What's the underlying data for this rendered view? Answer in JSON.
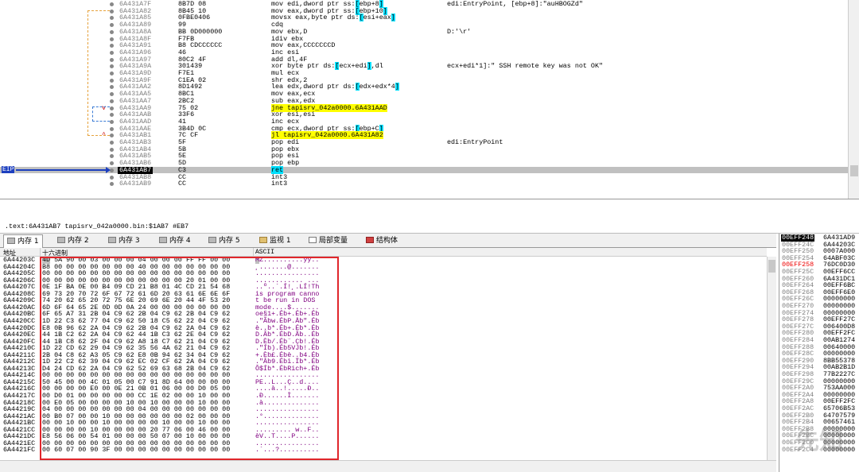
{
  "disasm": {
    "rows": [
      {
        "addr": "6A431A7F",
        "bytes": "8B7D 08",
        "instr": "mov edi,dword ptr ss:[ebp+8]",
        "comment": "edi:EntryPoint, [ebp+8]:\"auHBOGZd\""
      },
      {
        "addr": "6A431A82",
        "bytes": "8B45 10",
        "instr": "mov eax,dword ptr ss:[ebp+10]",
        "comment": ""
      },
      {
        "addr": "6A431A85",
        "bytes": "0FBE0406",
        "instr": "movsx eax,byte ptr ds:[esi+eax]",
        "comment": ""
      },
      {
        "addr": "6A431A89",
        "bytes": "99",
        "instr": "cdq",
        "comment": ""
      },
      {
        "addr": "6A431A8A",
        "bytes": "BB 0D000000",
        "instr": "mov ebx,D",
        "comment": "D:'\\r'"
      },
      {
        "addr": "6A431A8F",
        "bytes": "F7FB",
        "instr": "idiv ebx",
        "comment": ""
      },
      {
        "addr": "6A431A91",
        "bytes": "B8 CDCCCCCC",
        "instr": "mov eax,CCCCCCCD",
        "comment": ""
      },
      {
        "addr": "6A431A96",
        "bytes": "46",
        "instr": "inc esi",
        "comment": ""
      },
      {
        "addr": "6A431A97",
        "bytes": "80C2 4F",
        "instr": "add dl,4F",
        "comment": ""
      },
      {
        "addr": "6A431A9A",
        "bytes": "301439",
        "instr": "xor byte ptr ds:[ecx+edi],dl",
        "comment": "ecx+edi*1]:\" SSH remote key was not OK\""
      },
      {
        "addr": "6A431A9D",
        "bytes": "F7E1",
        "instr": "mul ecx",
        "comment": ""
      },
      {
        "addr": "6A431A9F",
        "bytes": "C1EA 02",
        "instr": "shr edx,2",
        "comment": ""
      },
      {
        "addr": "6A431AA2",
        "bytes": "8D1492",
        "instr": "lea edx,dword ptr ds:[edx+edx*4]",
        "comment": ""
      },
      {
        "addr": "6A431AA5",
        "bytes": "8BC1",
        "instr": "mov eax,ecx",
        "comment": ""
      },
      {
        "addr": "6A431AA7",
        "bytes": "2BC2",
        "instr": "sub eax,edx",
        "comment": ""
      },
      {
        "addr": "6A431AA9",
        "bytes": "75 02",
        "instr": "jne tapisrv_042a0000.6A431AAD",
        "comment": ""
      },
      {
        "addr": "6A431AAB",
        "bytes": "33F6",
        "instr": "xor esi,esi",
        "comment": ""
      },
      {
        "addr": "6A431AAD",
        "bytes": "41",
        "instr": "inc ecx",
        "comment": ""
      },
      {
        "addr": "6A431AAE",
        "bytes": "3B4D 0C",
        "instr": "cmp ecx,dword ptr ss:[ebp+C]",
        "comment": ""
      },
      {
        "addr": "6A431AB1",
        "bytes": "7C CF",
        "instr": "jl tapisrv_042a0000.6A431A82",
        "comment": ""
      },
      {
        "addr": "6A431AB3",
        "bytes": "5F",
        "instr": "pop edi",
        "comment": "edi:EntryPoint"
      },
      {
        "addr": "6A431AB4",
        "bytes": "5B",
        "instr": "pop ebx",
        "comment": ""
      },
      {
        "addr": "6A431AB5",
        "bytes": "5E",
        "instr": "pop esi",
        "comment": ""
      },
      {
        "addr": "6A431AB6",
        "bytes": "5D",
        "instr": "pop ebp",
        "comment": ""
      },
      {
        "addr": "6A431AB7",
        "bytes": "C3",
        "instr": "ret",
        "comment": ""
      },
      {
        "addr": "6A431AB8",
        "bytes": "CC",
        "instr": "int3",
        "comment": ""
      },
      {
        "addr": "6A431AB9",
        "bytes": "CC",
        "instr": "int3",
        "comment": ""
      }
    ],
    "eip_label": "EIP"
  },
  "infobar": {
    "text": ".text:6A431AB7 tapisrv_042a0000.bin:$1AB7 #EB7"
  },
  "tabs": [
    "内存 1",
    "内存 2",
    "内存 3",
    "内存 4",
    "内存 5",
    "监视 1",
    "局部变量",
    "结构体"
  ],
  "mem_header": {
    "addr": "地址",
    "hex": "十六进制",
    "ascii": "ASCII"
  },
  "memory": [
    {
      "addr": "6A44203C",
      "hex": "4D 5A 90 00 03 00 00 00 04 00 00 00 FF FF 00 00",
      "ascii": "MZ..........ÿÿ.."
    },
    {
      "addr": "6A44204C",
      "hex": "B8 00 00 00 00 00 00 00 40 00 00 00 00 00 00 00",
      "ascii": "¸.......@......."
    },
    {
      "addr": "6A44205C",
      "hex": "00 00 00 00 00 00 00 00 00 00 00 00 00 00 00 00",
      "ascii": "................"
    },
    {
      "addr": "6A44206C",
      "hex": "00 00 00 00 00 00 00 00 00 00 00 00 20 01 00 00",
      "ascii": "............ ..."
    },
    {
      "addr": "6A44207C",
      "hex": "0E 1F BA 0E 00 B4 09 CD 21 B8 01 4C CD 21 54 68",
      "ascii": "..º..´.Í!¸.LÍ!Th"
    },
    {
      "addr": "6A44208C",
      "hex": "69 73 20 70 72 6F 67 72 61 6D 20 63 61 6E 6E 6F",
      "ascii": "is program canno"
    },
    {
      "addr": "6A44209C",
      "hex": "74 20 62 65 20 72 75 6E 20 69 6E 20 44 4F 53 20",
      "ascii": "t be run in DOS "
    },
    {
      "addr": "6A4420AC",
      "hex": "6D 6F 64 65 2E 0D 0D 0A 24 00 00 00 00 00 00 00",
      "ascii": "mode....$......."
    },
    {
      "addr": "6A4420BC",
      "hex": "6F 65 A7 31 2B 04 C9 62 2B 04 C9 62 2B 04 C9 62",
      "ascii": "oe§1+.Éb+.Éb+.Éb"
    },
    {
      "addr": "6A4420CC",
      "hex": "1D 22 C3 62 77 04 C9 62 50 18 C5 62 22 04 C9 62",
      "ascii": ".\"Ãbw.ÉbP.Åb\".Éb"
    },
    {
      "addr": "6A4420DC",
      "hex": "E8 0B 96 62 2A 04 C9 62 2B 04 C9 62 2A 04 C9 62",
      "ascii": "è..b*.Éb+.Éb*.Éb"
    },
    {
      "addr": "6A4420EC",
      "hex": "44 1B C2 62 2A 04 C9 62 44 1B C3 62 2E 04 C9 62",
      "ascii": "D.Âb*.ÉbD.Ãb..Éb"
    },
    {
      "addr": "6A4420FC",
      "hex": "44 1B C8 62 2F 04 C9 62 A8 18 C7 62 21 04 C9 62",
      "ascii": "D.Èb/.Éb¨.Çb!.Éb"
    },
    {
      "addr": "6A44210C",
      "hex": "1D 22 CD 62 29 04 C9 62 35 56 4A 62 21 04 C9 62",
      "ascii": ".\"Íb).Éb5VJb!.Éb"
    },
    {
      "addr": "6A44211C",
      "hex": "2B 04 C8 62 A3 05 C9 62 E8 0B 94 62 34 04 C9 62",
      "ascii": "+.Èb£.Ébè..b4.Éb"
    },
    {
      "addr": "6A44212C",
      "hex": "1D 22 C2 62 39 04 C9 62 EC 02 CF 62 2A 04 C9 62",
      "ascii": ".\"Âb9.Ébì.Ïb*.Éb"
    },
    {
      "addr": "6A44213C",
      "hex": "D4 24 CD 62 2A 04 C9 62 52 69 63 68 2B 04 C9 62",
      "ascii": "Ô$Íb*.ÉbRich+.Éb"
    },
    {
      "addr": "6A44214C",
      "hex": "00 00 00 00 00 00 00 00 00 00 00 00 00 00 00 00",
      "ascii": "................"
    },
    {
      "addr": "6A44215C",
      "hex": "50 45 00 00 4C 01 05 00 C7 91 8D 64 00 00 00 00",
      "ascii": "PE..L...Ç..d...."
    },
    {
      "addr": "6A44216C",
      "hex": "00 00 00 00 E0 00 0E 21 0B 01 06 00 00 D0 05 00",
      "ascii": "....à..!.....Ð.."
    },
    {
      "addr": "6A44217C",
      "hex": "00 D0 01 00 00 00 00 00 CC 1E 02 00 00 10 00 00",
      "ascii": ".Ð......Ì......."
    },
    {
      "addr": "6A44218C",
      "hex": "00 E0 05 00 00 00 00 10 00 10 00 00 00 10 00 00",
      "ascii": ".à.............."
    },
    {
      "addr": "6A44219C",
      "hex": "04 00 00 00 00 00 00 00 04 00 00 00 00 00 00 00",
      "ascii": "................"
    },
    {
      "addr": "6A4421AC",
      "hex": "00 B0 07 00 00 10 00 00 00 00 00 00 02 00 00 00",
      "ascii": ".°.............."
    },
    {
      "addr": "6A4421BC",
      "hex": "00 00 10 00 00 10 00 00 00 00 10 00 00 10 00 00",
      "ascii": "................"
    },
    {
      "addr": "6A4421CC",
      "hex": "00 00 00 00 10 00 00 00 00 20 77 06 00 46 00 00",
      "ascii": "......... w..F.."
    },
    {
      "addr": "6A4421DC",
      "hex": "E8 56 06 00 54 01 00 00 00 50 07 00 10 00 00 00",
      "ascii": "èV..T....P......"
    },
    {
      "addr": "6A4421EC",
      "hex": "00 00 00 00 00 00 00 00 00 00 00 00 00 00 00 00",
      "ascii": "................"
    },
    {
      "addr": "6A4421FC",
      "hex": "00 60 07 00 90 3F 00 00 00 00 00 00 00 00 00 00",
      "ascii": ".`...?.........."
    }
  ],
  "stack": [
    {
      "addr": "00EFF248",
      "val": "6A431AD9"
    },
    {
      "addr": "00EFF24C",
      "val": "6A44203C"
    },
    {
      "addr": "00EFF250",
      "val": "0007A000"
    },
    {
      "addr": "00EFF254",
      "val": "64ABF03C"
    },
    {
      "addr": "00EFF258",
      "val": "76DC0D30"
    },
    {
      "addr": "00EFF25C",
      "val": "00EFF6CC"
    },
    {
      "addr": "00EFF260",
      "val": "6A431DC1"
    },
    {
      "addr": "00EFF264",
      "val": "00EFF6BC"
    },
    {
      "addr": "00EFF268",
      "val": "00EFF6E0"
    },
    {
      "addr": "00EFF26C",
      "val": "00000000"
    },
    {
      "addr": "00EFF270",
      "val": "00000000"
    },
    {
      "addr": "00EFF274",
      "val": "00000000"
    },
    {
      "addr": "00EFF278",
      "val": "00EFF27C"
    },
    {
      "addr": "00EFF27C",
      "val": "006400D8"
    },
    {
      "addr": "00EFF280",
      "val": "00EFF2FC"
    },
    {
      "addr": "00EFF284",
      "val": "00AB1274"
    },
    {
      "addr": "00EFF288",
      "val": "00640000"
    },
    {
      "addr": "00EFF28C",
      "val": "00000000"
    },
    {
      "addr": "00EFF290",
      "val": "8BB55378"
    },
    {
      "addr": "00EFF294",
      "val": "00AB2B1D"
    },
    {
      "addr": "00EFF298",
      "val": "77B2227C"
    },
    {
      "addr": "00EFF29C",
      "val": "00000000"
    },
    {
      "addr": "00EFF2A0",
      "val": "753AA000"
    },
    {
      "addr": "00EFF2A4",
      "val": "00000000"
    },
    {
      "addr": "00EFF2A8",
      "val": "00EFF2FC"
    },
    {
      "addr": "00EFF2AC",
      "val": "65706B53"
    },
    {
      "addr": "00EFF2B0",
      "val": "64707579"
    },
    {
      "addr": "00EFF2B4",
      "val": "00657461"
    },
    {
      "addr": "00EFF2B8",
      "val": "00000000"
    },
    {
      "addr": "00EFF2BC",
      "val": "00000000"
    },
    {
      "addr": "00EFF2C0",
      "val": "00000000"
    },
    {
      "addr": "00EFF2C4",
      "val": "00000000"
    }
  ],
  "watermark": "先知"
}
